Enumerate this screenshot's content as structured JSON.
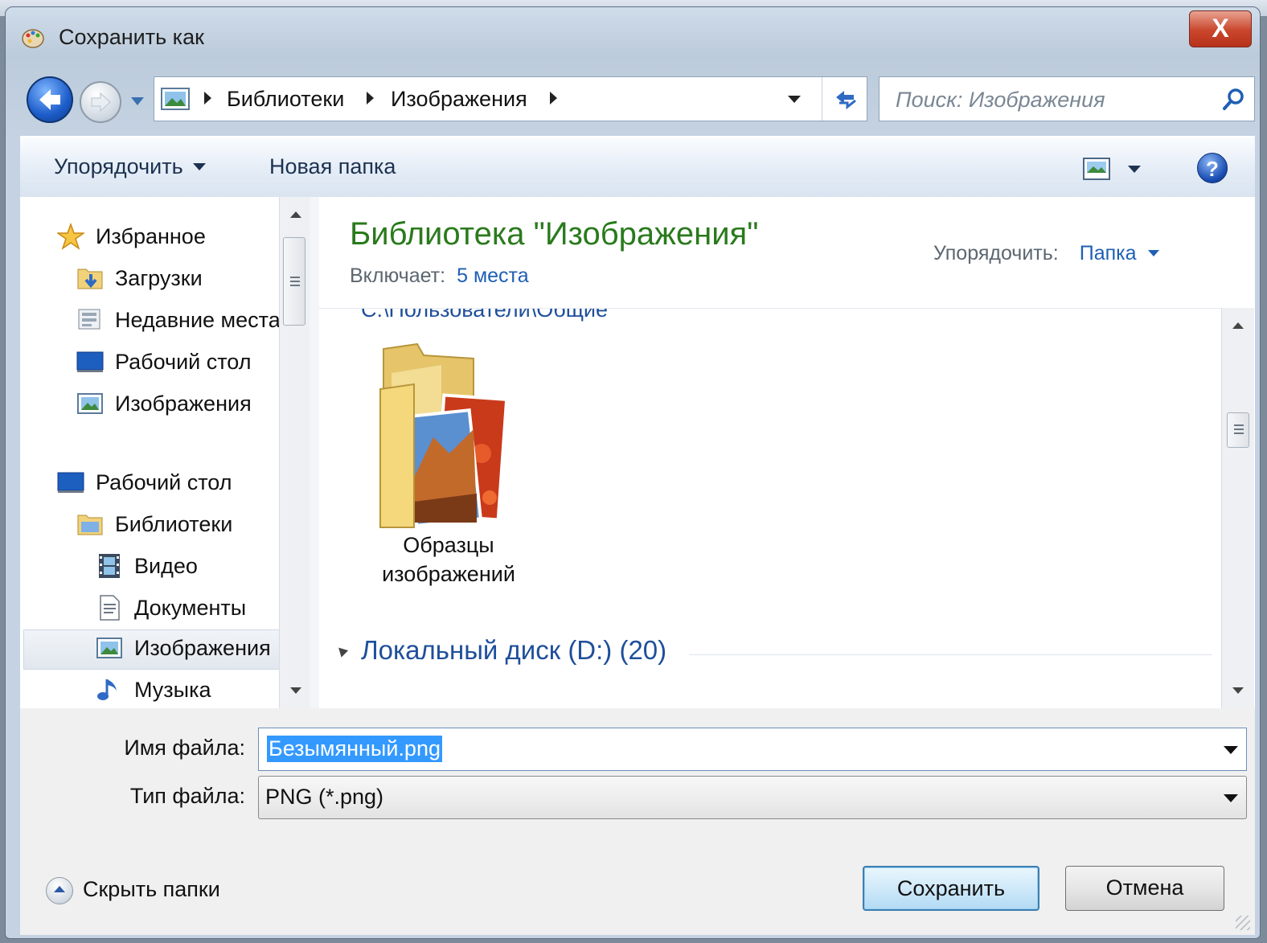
{
  "window": {
    "title": "Сохранить как",
    "close_label": "X"
  },
  "address_bar": {
    "segments": [
      "Библиотеки",
      "Изображения"
    ]
  },
  "search": {
    "placeholder": "Поиск: Изображения"
  },
  "toolbar": {
    "organize_label": "Упорядочить",
    "new_folder_label": "Новая папка",
    "help_label": "?"
  },
  "sidebar": {
    "favorites": {
      "label": "Избранное",
      "items": [
        "Загрузки",
        "Недавние места",
        "Рабочий стол",
        "Изображения"
      ]
    },
    "desktop": {
      "label": "Рабочий стол"
    },
    "libraries": {
      "label": "Библиотеки",
      "items": [
        "Видео",
        "Документы",
        "Изображения",
        "Музыка"
      ],
      "selected": "Изображения"
    }
  },
  "content": {
    "library_title": "Библиотека \"Изображения\"",
    "includes_label": "Включает:",
    "includes_value": "5 места",
    "arrange_label": "Упорядочить:",
    "arrange_value": "Папка",
    "path_header": "C:\\Пользователи\\Общие",
    "folder": {
      "line1": "Образцы",
      "line2": "изображений"
    },
    "group_header": "Локальный диск (D:) (20)"
  },
  "form": {
    "filename_label": "Имя файла:",
    "filename_value": "Безымянный.png",
    "filetype_label": "Тип файла:",
    "filetype_value": "PNG (*.png)"
  },
  "footer": {
    "hide_folders_label": "Скрыть папки",
    "save_label": "Сохранить",
    "cancel_label": "Отмена"
  },
  "colors": {
    "library_title": "#2a7a1c",
    "link": "#1f5fb4",
    "selection": "#3399ff"
  }
}
